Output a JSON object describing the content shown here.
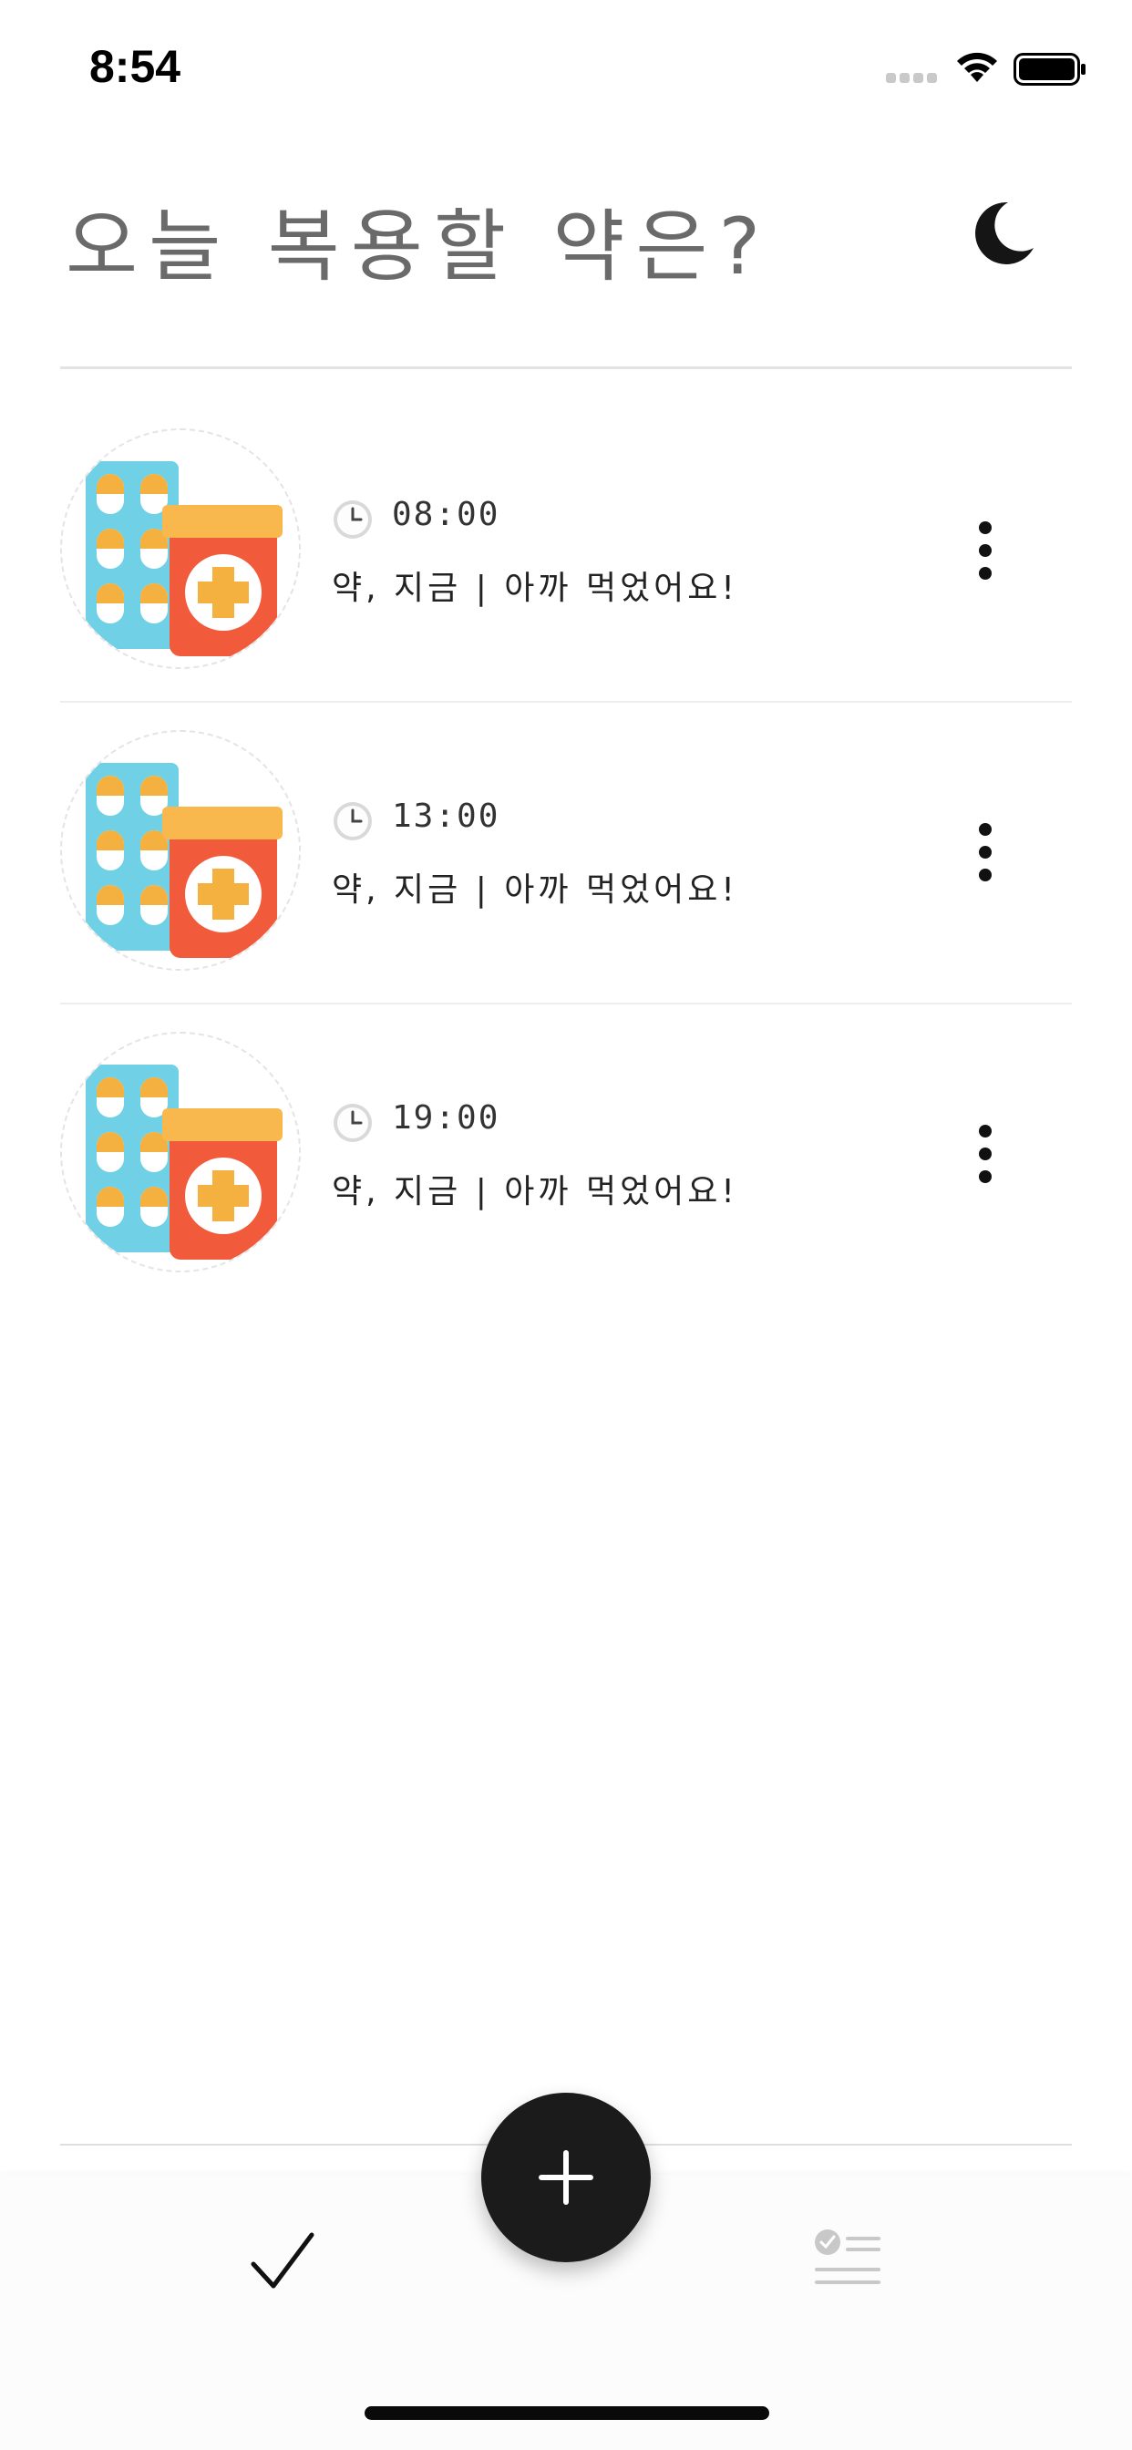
{
  "status_bar": {
    "time": "8:54",
    "icons": [
      "cellular-signal-icon",
      "wifi-icon",
      "battery-icon"
    ]
  },
  "header": {
    "title": "오늘 복용할 약은?",
    "theme_toggle_icon": "moon-icon"
  },
  "medications": [
    {
      "time": "08:00",
      "status_text": "약, 지금 | 아까 먹었어요!",
      "image_icon": "medicine-bottle-and-pills-icon"
    },
    {
      "time": "13:00",
      "status_text": "약, 지금 | 아까 먹었어요!",
      "image_icon": "medicine-bottle-and-pills-icon"
    },
    {
      "time": "19:00",
      "status_text": "약, 지금 | 아까 먹었어요!",
      "image_icon": "medicine-bottle-and-pills-icon"
    }
  ],
  "tab_bar": {
    "tabs": [
      {
        "icon": "checkmark-icon",
        "active": true
      },
      {
        "icon": "checklist-icon",
        "active": false
      }
    ],
    "add_button_icon": "plus-icon"
  },
  "colors": {
    "title": "#6a6a6a",
    "pill_blister": "#6fd0e6",
    "pill_cap": "#f5b13f",
    "bottle_body": "#f15a3a",
    "bottle_cap": "#f8b84e",
    "cross": "#f5b13f",
    "fab": "#1b1b1b",
    "inactive_tab": "#c8c8c8"
  }
}
